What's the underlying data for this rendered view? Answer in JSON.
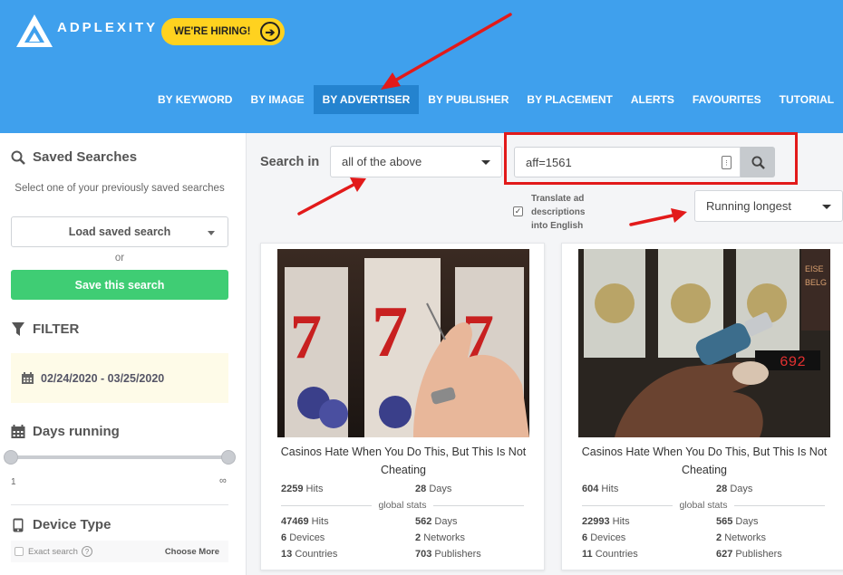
{
  "header": {
    "logo_text": "ADPLEXITY",
    "hiring_label": "WE'RE HIRING!",
    "nav": [
      {
        "label": "BY KEYWORD",
        "active": false
      },
      {
        "label": "BY IMAGE",
        "active": false
      },
      {
        "label": "BY ADVERTISER",
        "active": true
      },
      {
        "label": "BY PUBLISHER",
        "active": false
      },
      {
        "label": "BY PLACEMENT",
        "active": false
      },
      {
        "label": "ALERTS",
        "active": false
      },
      {
        "label": "FAVOURITES",
        "active": false
      },
      {
        "label": "TUTORIAL",
        "active": false
      }
    ],
    "settings_icon": "gear-icon"
  },
  "sidebar": {
    "saved_title": "Saved Searches",
    "saved_help": "Select one of your previously saved searches",
    "load_label": "Load saved search",
    "or_label": "or",
    "save_label": "Save this search",
    "filter_title": "FILTER",
    "date_range": "02/24/2020 - 03/25/2020",
    "days_title": "Days running",
    "days_min": "1",
    "days_max": "∞",
    "device_title": "Device Type",
    "exact_search_label": "Exact search",
    "choose_more_label": "Choose More"
  },
  "search": {
    "label": "Search in",
    "scope_value": "all of the above",
    "query_value": "aff=1561",
    "translate_label": "Translate ad descriptions into English",
    "translate_checked": true,
    "sort_value": "Running longest"
  },
  "colors": {
    "header_bg": "#3fa0ed",
    "active_nav": "#2483cf",
    "hiring_bg": "#ffd21f",
    "save_btn": "#3fcd74",
    "annotation_red": "#e21a1a"
  },
  "ads": [
    {
      "title": "Casinos Hate When You Do This, But This Is Not Cheating",
      "hits": "2259",
      "hits_label": "Hits",
      "days": "28",
      "days_label": "Days",
      "global_label": "global stats",
      "global_hits": "47469",
      "global_hits_label": "Hits",
      "global_days": "562",
      "global_days_label": "Days",
      "devices": "6",
      "devices_label": "Devices",
      "networks": "2",
      "networks_label": "Networks",
      "countries": "13",
      "countries_label": "Countries",
      "publishers": "703",
      "publishers_label": "Publishers"
    },
    {
      "title": "Casinos Hate When You Do This, But This Is Not Cheating",
      "hits": "604",
      "hits_label": "Hits",
      "days": "28",
      "days_label": "Days",
      "global_label": "global stats",
      "global_hits": "22993",
      "global_hits_label": "Hits",
      "global_days": "565",
      "global_days_label": "Days",
      "devices": "6",
      "devices_label": "Devices",
      "networks": "2",
      "networks_label": "Networks",
      "countries": "11",
      "countries_label": "Countries",
      "publishers": "627",
      "publishers_label": "Publishers"
    }
  ]
}
